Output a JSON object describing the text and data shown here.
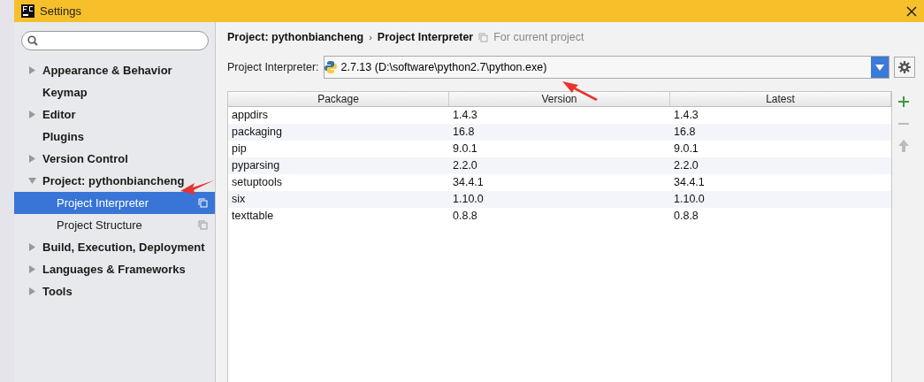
{
  "window": {
    "title": "Settings"
  },
  "sidebar": {
    "items": [
      {
        "label": "Appearance & Behavior",
        "expandable": true,
        "expanded": false,
        "selected": false
      },
      {
        "label": "Keymap",
        "expandable": false,
        "selected": false
      },
      {
        "label": "Editor",
        "expandable": true,
        "expanded": false,
        "selected": false
      },
      {
        "label": "Plugins",
        "expandable": false,
        "selected": false
      },
      {
        "label": "Version Control",
        "expandable": true,
        "expanded": false,
        "selected": false
      },
      {
        "label": "Project: pythonbiancheng",
        "expandable": true,
        "expanded": true,
        "selected": false,
        "children": [
          {
            "label": "Project Interpreter",
            "selected": true
          },
          {
            "label": "Project Structure",
            "selected": false
          }
        ]
      },
      {
        "label": "Build, Execution, Deployment",
        "expandable": true,
        "expanded": false,
        "selected": false
      },
      {
        "label": "Languages & Frameworks",
        "expandable": true,
        "expanded": false,
        "selected": false
      },
      {
        "label": "Tools",
        "expandable": true,
        "expanded": false,
        "selected": false
      }
    ]
  },
  "breadcrumb": [
    "Project: pythonbiancheng",
    "Project Interpreter"
  ],
  "breadcrumb_separator": "›",
  "scope_note": "For current project",
  "interpreter": {
    "label": "Project Interpreter:",
    "value": "2.7.13 (D:\\software\\python2.7\\python.exe)"
  },
  "table": {
    "columns": [
      "Package",
      "Version",
      "Latest"
    ],
    "rows": [
      [
        "appdirs",
        "1.4.3",
        "1.4.3"
      ],
      [
        "packaging",
        "16.8",
        "16.8"
      ],
      [
        "pip",
        "9.0.1",
        "9.0.1"
      ],
      [
        "pyparsing",
        "2.2.0",
        "2.2.0"
      ],
      [
        "setuptools",
        "34.4.1",
        "34.4.1"
      ],
      [
        "six",
        "1.10.0",
        "1.10.0"
      ],
      [
        "texttable",
        "0.8.8",
        "0.8.8"
      ]
    ]
  },
  "table_tools": [
    {
      "kind": "add",
      "disabled": false
    },
    {
      "kind": "remove",
      "disabled": true
    },
    {
      "kind": "upgrade",
      "disabled": true
    }
  ]
}
